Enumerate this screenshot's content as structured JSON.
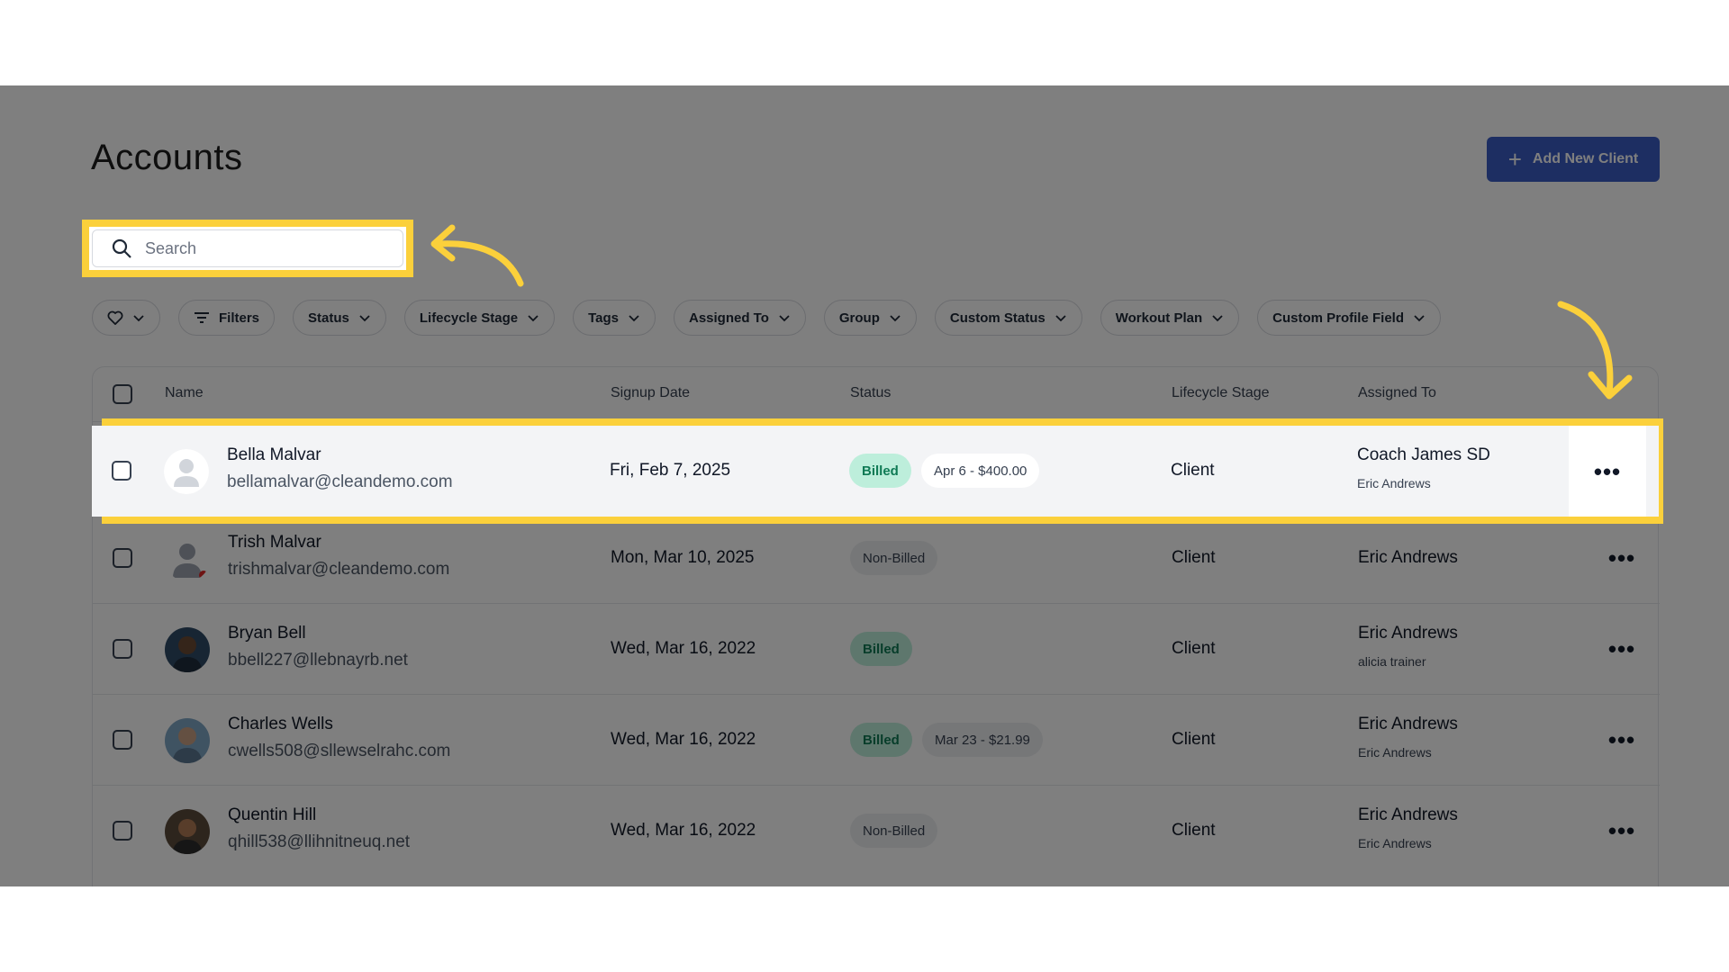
{
  "page": {
    "title": "Accounts"
  },
  "header": {
    "add_button_label": "Add New Client"
  },
  "search": {
    "placeholder": "Search"
  },
  "filters": [
    "Filters",
    "Status",
    "Lifecycle Stage",
    "Tags",
    "Assigned To",
    "Group",
    "Custom Status",
    "Workout Plan",
    "Custom Profile Field"
  ],
  "table": {
    "columns": [
      "Name",
      "Signup Date",
      "Status",
      "Lifecycle Stage",
      "Assigned To"
    ],
    "rows": [
      {
        "name": "Bella Malvar",
        "email": "bellamalvar@cleandemo.com",
        "signup": "Fri, Feb 7, 2025",
        "status": "Billed",
        "payment": "Apr 6 - $400.00",
        "lifecycle": "Client",
        "assigned": "Coach James SD",
        "assigned_secondary": "Eric Andrews",
        "avatar": "placeholder"
      },
      {
        "name": "Trish Malvar",
        "email": "trishmalvar@cleandemo.com",
        "signup": "Mon, Mar 10, 2025",
        "status": "Non-Billed",
        "payment": "",
        "lifecycle": "Client",
        "assigned": "Eric Andrews",
        "assigned_secondary": "",
        "avatar": "silhouette"
      },
      {
        "name": "Bryan Bell",
        "email": "bbell227@llebnayrb.net",
        "signup": "Wed, Mar 16, 2022",
        "status": "Billed",
        "payment": "",
        "lifecycle": "Client",
        "assigned": "Eric Andrews",
        "assigned_secondary": "alicia trainer",
        "avatar": "photo"
      },
      {
        "name": "Charles Wells",
        "email": "cwells508@sllewselrahc.com",
        "signup": "Wed, Mar 16, 2022",
        "status": "Billed",
        "payment": "Mar 23 - $21.99",
        "lifecycle": "Client",
        "assigned": "Eric Andrews",
        "assigned_secondary": "Eric Andrews",
        "avatar": "photo"
      },
      {
        "name": "Quentin Hill",
        "email": "qhill538@llihnitneuq.net",
        "signup": "Wed, Mar 16, 2022",
        "status": "Non-Billed",
        "payment": "",
        "lifecycle": "Client",
        "assigned": "Eric Andrews",
        "assigned_secondary": "Eric Andrews",
        "avatar": "photo"
      }
    ]
  },
  "icons": [
    "heart-icon",
    "filter-icon",
    "chevron-down-icon",
    "search-icon",
    "plus-icon",
    "more-options-icon"
  ],
  "colors": {
    "highlight": "#fbd03b",
    "primary": "#3b5cc5",
    "billed_bg": "#bdeedb",
    "billed_text": "#0f7a55"
  }
}
